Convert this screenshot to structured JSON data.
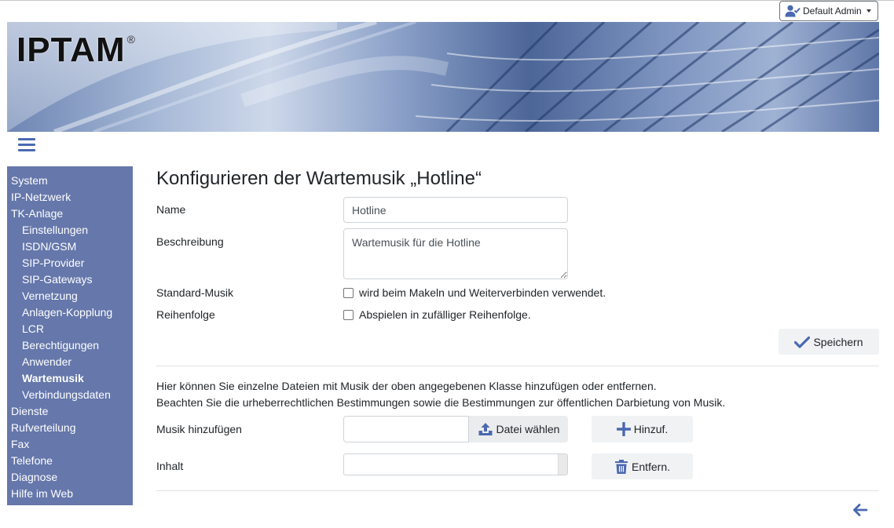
{
  "header": {
    "user_label": "Default Admin",
    "logo_text": "IPTAM",
    "logo_mark": "®"
  },
  "sidebar": {
    "items": [
      {
        "label": "System",
        "level": 0,
        "active": false
      },
      {
        "label": "IP-Netzwerk",
        "level": 0,
        "active": false
      },
      {
        "label": "TK-Anlage",
        "level": 0,
        "active": false
      },
      {
        "label": "Einstellungen",
        "level": 1,
        "active": false
      },
      {
        "label": "ISDN/GSM",
        "level": 1,
        "active": false
      },
      {
        "label": "SIP-Provider",
        "level": 1,
        "active": false
      },
      {
        "label": "SIP-Gateways",
        "level": 1,
        "active": false
      },
      {
        "label": "Vernetzung",
        "level": 1,
        "active": false
      },
      {
        "label": "Anlagen-Kopplung",
        "level": 1,
        "active": false
      },
      {
        "label": "LCR",
        "level": 1,
        "active": false
      },
      {
        "label": "Berechtigungen",
        "level": 1,
        "active": false
      },
      {
        "label": "Anwender",
        "level": 1,
        "active": false
      },
      {
        "label": "Wartemusik",
        "level": 1,
        "active": true
      },
      {
        "label": "Verbindungsdaten",
        "level": 1,
        "active": false
      },
      {
        "label": "Dienste",
        "level": 0,
        "active": false
      },
      {
        "label": "Rufverteilung",
        "level": 0,
        "active": false
      },
      {
        "label": "Fax",
        "level": 0,
        "active": false
      },
      {
        "label": "Telefone",
        "level": 0,
        "active": false
      },
      {
        "label": "Diagnose",
        "level": 0,
        "active": false
      },
      {
        "label": "Hilfe im Web",
        "level": 0,
        "active": false
      }
    ]
  },
  "main": {
    "title": "Konfigurieren der Wartemusik „Hotline“",
    "form": {
      "name_label": "Name",
      "name_value": "Hotline",
      "description_label": "Beschreibung",
      "description_value": "Wartemusik für die Hotline",
      "default_music_label": "Standard-Musik",
      "default_music_text": "wird beim Makeln und Weiterverbinden verwendet.",
      "default_music_checked": false,
      "order_label": "Reihenfolge",
      "order_text": "Abspielen in zufälliger Reihenfolge.",
      "order_checked": false,
      "save_label": "Speichern"
    },
    "files": {
      "info_line1": "Hier können Sie einzelne Dateien mit Musik der oben angegebenen Klasse hinzufügen oder entfernen.",
      "info_line2": "Beachten Sie die urheberrechtlichen Bestimmungen sowie die Bestimmungen zur öffentlichen Darbietung von Musik.",
      "add_label": "Musik hinzufügen",
      "file_value": "",
      "choose_file_label": "Datei wählen",
      "add_button_label": "Hinzuf.",
      "content_label": "Inhalt",
      "remove_button_label": "Entfern."
    }
  },
  "colors": {
    "sidebar_bg": "#6577ab",
    "accent_icon": "#4a69b1"
  },
  "icons": {
    "user": "user-check-icon",
    "menu": "hamburger-icon",
    "save": "check-icon",
    "upload": "upload-icon",
    "add": "plus-icon",
    "remove": "trash-icon",
    "back": "arrow-left-icon"
  }
}
